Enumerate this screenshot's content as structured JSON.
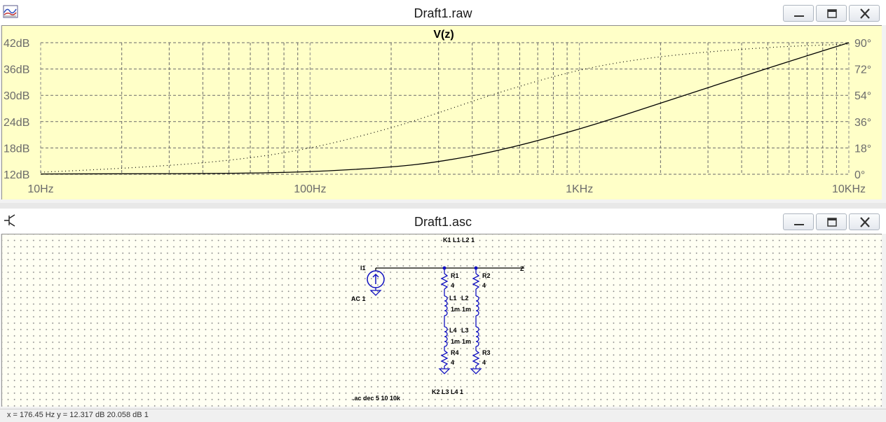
{
  "plot_window": {
    "title": "Draft1.raw",
    "app_icon": "waveform-viewer-icon",
    "buttons": [
      "minimize-icon",
      "maximize-icon",
      "close-icon"
    ]
  },
  "schematic_window": {
    "title": "Draft1.asc",
    "app_icon": "schematic-icon",
    "buttons": [
      "minimize-icon",
      "maximize-icon",
      "close-icon"
    ]
  },
  "chart_data": {
    "type": "line",
    "title": "V(z)",
    "x_scale": "log",
    "x_range": [
      10,
      10000
    ],
    "x_ticks": [
      {
        "value": 10,
        "label": "10Hz"
      },
      {
        "value": 100,
        "label": "100Hz"
      },
      {
        "value": 1000,
        "label": "1KHz"
      },
      {
        "value": 10000,
        "label": "10KHz"
      }
    ],
    "y_left": {
      "range": [
        12,
        42
      ],
      "ticks": [
        "12dB",
        "18dB",
        "24dB",
        "30dB",
        "36dB",
        "42dB"
      ]
    },
    "y_right": {
      "range": [
        0,
        90
      ],
      "ticks": [
        "0°",
        "18°",
        "36°",
        "54°",
        "72°",
        "90°"
      ]
    },
    "grid": true,
    "series": [
      {
        "axis": "left",
        "style": "solid",
        "color": "#000000",
        "x": [
          10,
          20,
          50,
          100,
          200,
          300,
          500,
          1000,
          2000,
          5000,
          10000
        ],
        "y": [
          12.06,
          12.09,
          12.19,
          12.51,
          13.6,
          14.8,
          17.3,
          22.2,
          28.2,
          36.2,
          42.0
        ]
      },
      {
        "axis": "right",
        "style": "dotted",
        "color": "#000000",
        "x": [
          10,
          20,
          50,
          100,
          200,
          300,
          500,
          1000,
          2000,
          5000,
          10000
        ],
        "y": [
          1.4,
          3.8,
          9.0,
          17.3,
          31.5,
          42.0,
          56.0,
          72.0,
          81.0,
          87.0,
          89.0
        ]
      }
    ]
  },
  "schematic": {
    "directive_top": "K1 L1 L2 1",
    "directive_bottom": "K2 L3 L4 1",
    "sim_command": ".ac dec 5 10 10k",
    "source": {
      "name": "I1",
      "value": "AC 1"
    },
    "net_label": "Z",
    "components": [
      {
        "name": "R1",
        "value": "4"
      },
      {
        "name": "R2",
        "value": "4"
      },
      {
        "name": "L1",
        "value": "1m"
      },
      {
        "name": "L2",
        "value": "1m"
      },
      {
        "name": "L4",
        "value": "1m"
      },
      {
        "name": "L3",
        "value": "1m"
      },
      {
        "name": "R4",
        "value": "4"
      },
      {
        "name": "R3",
        "value": "4"
      }
    ]
  },
  "status_bar": {
    "text": "x = 176.45 Hz     y = 12.317 dB  20.058 dB   1"
  }
}
